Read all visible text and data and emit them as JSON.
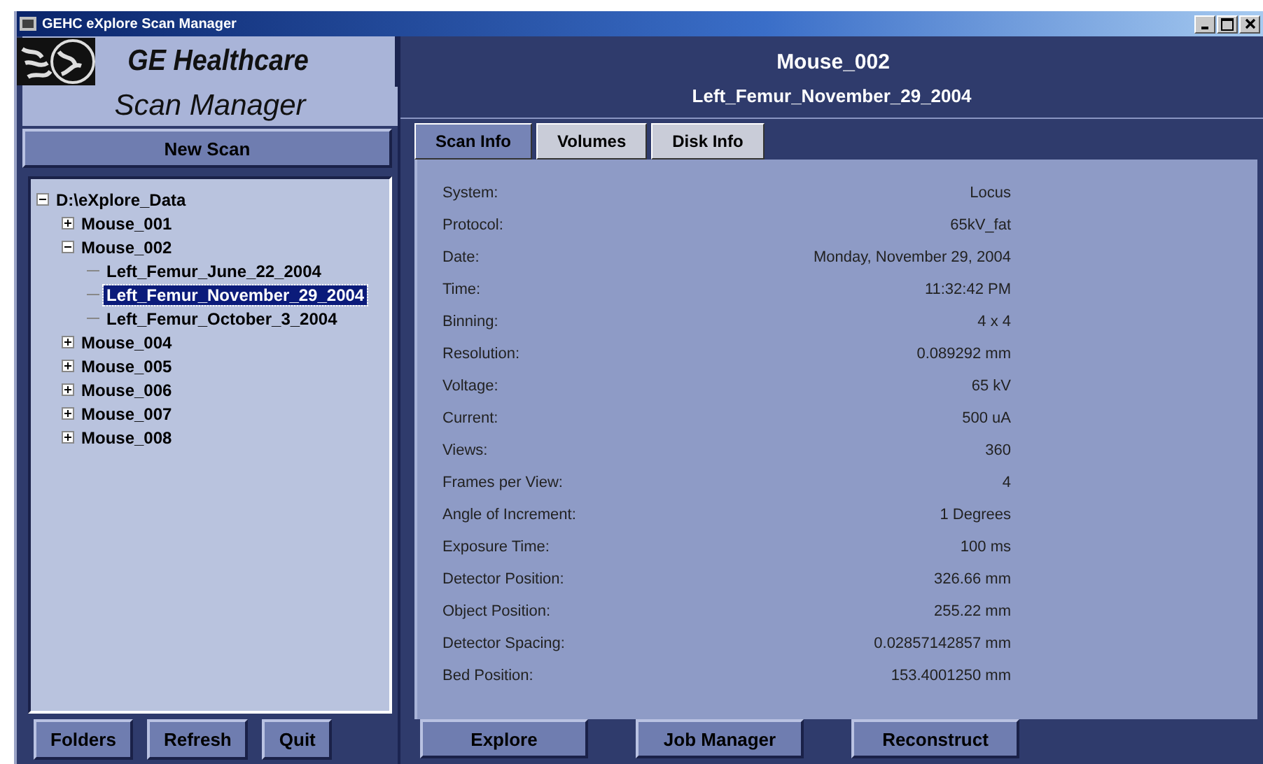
{
  "window": {
    "title": "GEHC eXplore Scan Manager"
  },
  "brand": {
    "name": "GE Healthcare",
    "product": "Scan Manager"
  },
  "new_scan_button": {
    "label": "New Scan"
  },
  "tree": {
    "label": "D:\\eXplore_Data",
    "expanded": true,
    "selected": false,
    "children": [
      {
        "label": "Mouse_001",
        "expanded": false,
        "selected": false
      },
      {
        "label": "Mouse_002",
        "expanded": true,
        "selected": false,
        "children": [
          {
            "label": "Left_Femur_June_22_2004",
            "selected": false
          },
          {
            "label": "Left_Femur_November_29_2004",
            "selected": true
          },
          {
            "label": "Left_Femur_October_3_2004",
            "selected": false
          }
        ]
      },
      {
        "label": "Mouse_004",
        "expanded": false,
        "selected": false
      },
      {
        "label": "Mouse_005",
        "expanded": false,
        "selected": false
      },
      {
        "label": "Mouse_006",
        "expanded": false,
        "selected": false
      },
      {
        "label": "Mouse_007",
        "expanded": false,
        "selected": false
      },
      {
        "label": "Mouse_008",
        "expanded": false,
        "selected": false
      }
    ]
  },
  "left_buttons": [
    {
      "label": "Folders"
    },
    {
      "label": "Refresh"
    },
    {
      "label": "Quit"
    }
  ],
  "header": {
    "title": "Mouse_002",
    "subtitle": "Left_Femur_November_29_2004"
  },
  "tabs": [
    {
      "label": "Scan Info",
      "selected": true
    },
    {
      "label": "Volumes",
      "selected": false
    },
    {
      "label": "Disk Info",
      "selected": false
    }
  ],
  "scan_info": [
    {
      "label": "System:",
      "value": "Locus"
    },
    {
      "label": "Protocol:",
      "value": "65kV_fat"
    },
    {
      "label": "Date:",
      "value": "Monday, November 29, 2004"
    },
    {
      "label": "Time:",
      "value": "11:32:42 PM"
    },
    {
      "label": "Binning:",
      "value": "4 x 4"
    },
    {
      "label": "Resolution:",
      "value": "0.089292 mm"
    },
    {
      "label": "Voltage:",
      "value": "65 kV"
    },
    {
      "label": "Current:",
      "value": "500 uA"
    },
    {
      "label": "Views:",
      "value": "360"
    },
    {
      "label": "Frames per View:",
      "value": "4"
    },
    {
      "label": "Angle of Increment:",
      "value": "1 Degrees"
    },
    {
      "label": "Exposure Time:",
      "value": "100 ms"
    },
    {
      "label": "Detector Position:",
      "value": "326.66 mm"
    },
    {
      "label": "Object Position:",
      "value": "255.22 mm"
    },
    {
      "label": "Detector Spacing:",
      "value": "0.02857142857 mm"
    },
    {
      "label": "Bed Position:",
      "value": "153.4001250 mm"
    }
  ],
  "action_buttons": [
    {
      "label": "Explore"
    },
    {
      "label": "Job Manager"
    },
    {
      "label": "Reconstruct"
    }
  ]
}
